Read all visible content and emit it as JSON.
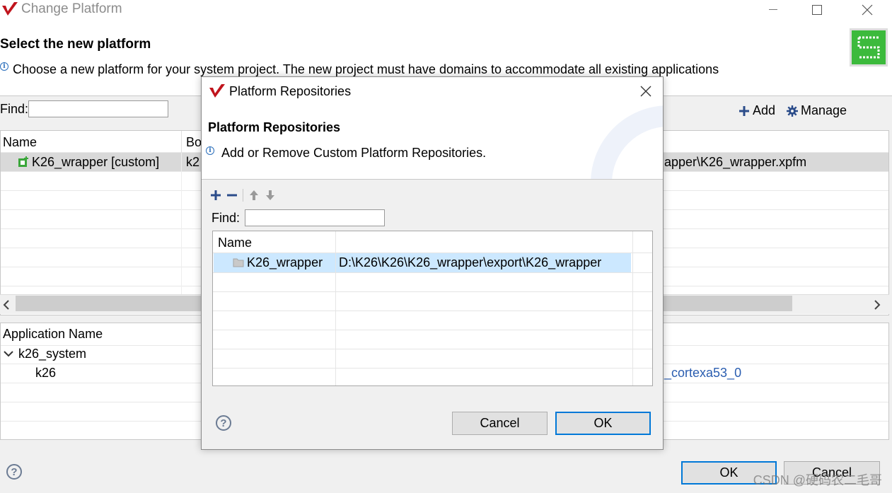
{
  "window": {
    "title": "Change Platform",
    "heading": "Select the new platform",
    "description": "Choose a new platform for your system project. The new project must have domains to accommodate all existing applications",
    "find_label": "Find:",
    "find_value": "",
    "add_label": "Add",
    "manage_label": "Manage",
    "platform_table": {
      "columns": [
        "Name",
        "Bo"
      ],
      "rows": [
        {
          "name": "K26_wrapper [custom]",
          "board": "k2",
          "path": "apper\\K26_wrapper.xpfm"
        }
      ]
    },
    "app_table": {
      "columns": [
        "Application Name"
      ],
      "system": "k26_system",
      "app": "k26",
      "domain": "_cortexa53_0"
    },
    "ok_label": "OK",
    "cancel_label": "Cancel"
  },
  "dialog": {
    "title": "Platform Repositories",
    "heading": "Platform Repositories",
    "description": "Add or Remove Custom Platform Repositories.",
    "find_label": "Find:",
    "find_value": "",
    "table": {
      "columns": [
        "Name",
        ""
      ],
      "rows": [
        {
          "name": "K26_wrapper",
          "path": "D:\\K26\\K26\\K26_wrapper\\export\\K26_wrapper"
        }
      ]
    },
    "cancel_label": "Cancel",
    "ok_label": "OK"
  },
  "watermark": "CSDN @硬码农二毛哥",
  "colors": {
    "accent": "#0078d7",
    "selection": "#cce8ff",
    "brand_red": "#c0141c",
    "logo_green": "#3cba3c",
    "link_blue": "#2a5db0"
  }
}
